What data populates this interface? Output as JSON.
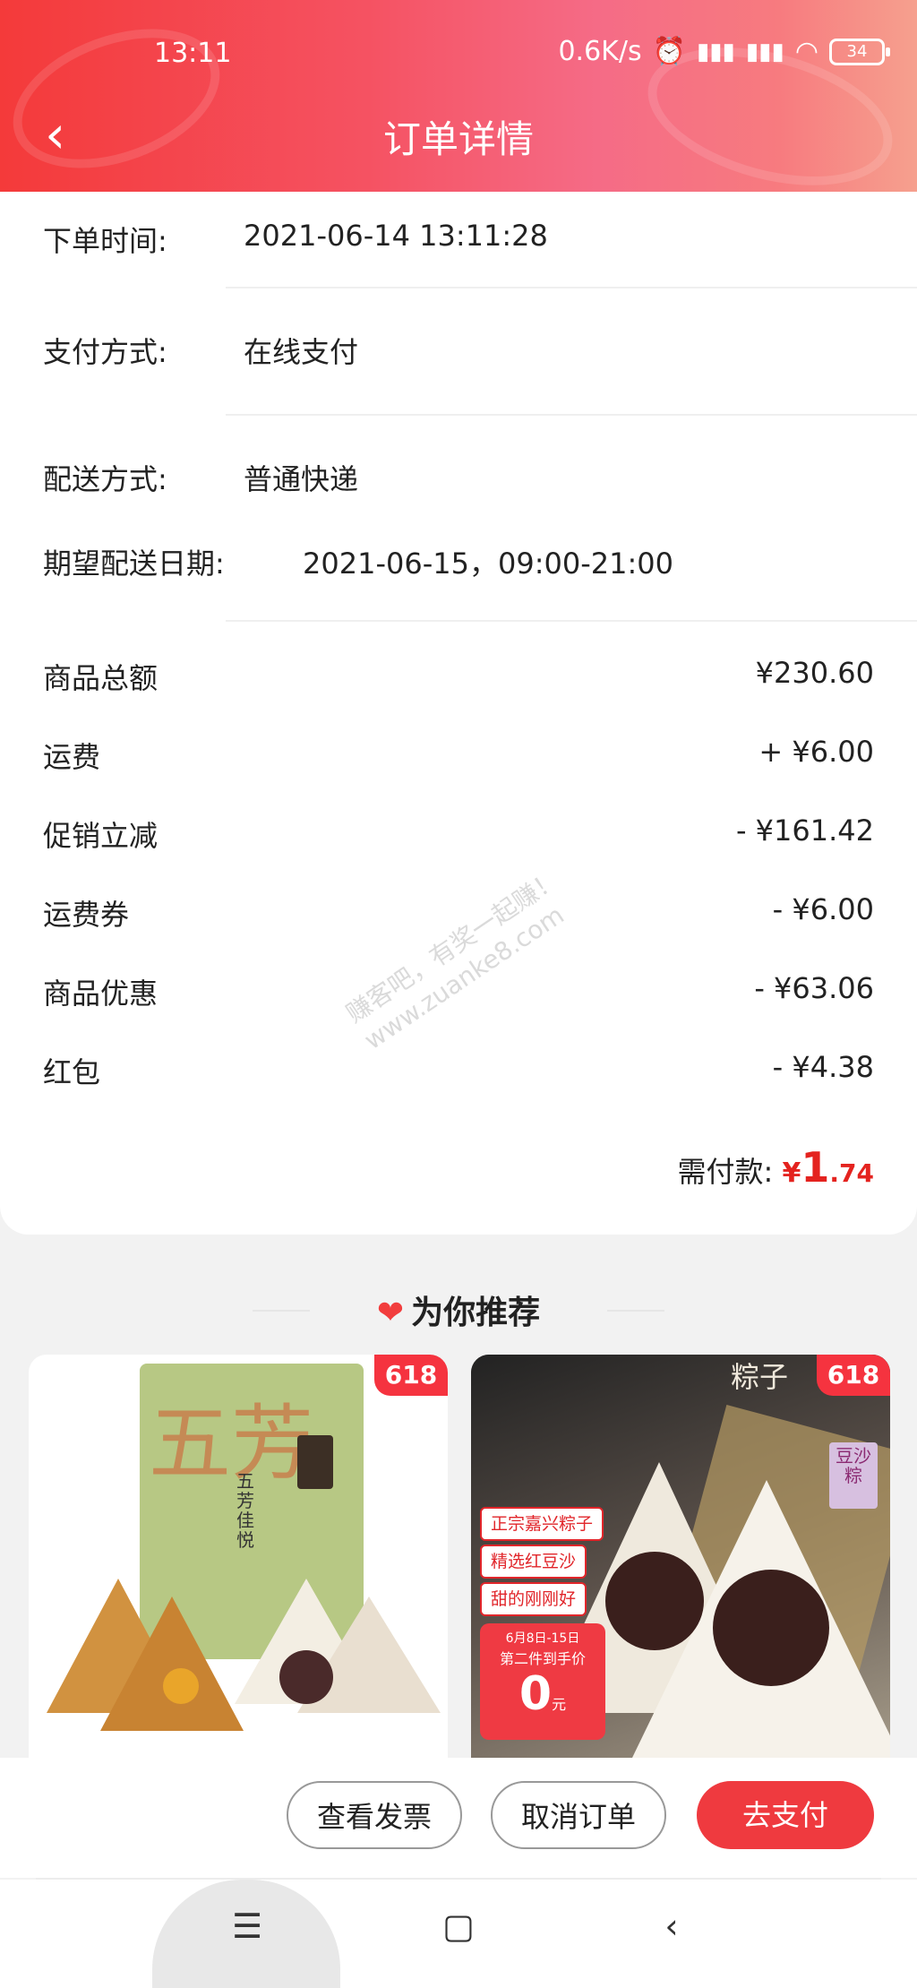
{
  "status_bar": {
    "time": "13:11",
    "speed": "0.6K/s",
    "battery": "34"
  },
  "header": {
    "title": "订单详情"
  },
  "order_info": {
    "order_time_label": "下单时间:",
    "order_time": "2021-06-14 13:11:28",
    "payment_label": "支付方式:",
    "payment": "在线支付",
    "delivery_label": "配送方式:",
    "delivery": "普通快递",
    "expected_label": "期望配送日期:",
    "expected": "2021-06-15，09:00-21:00"
  },
  "fees": [
    {
      "label": "商品总额",
      "value": "¥230.60"
    },
    {
      "label": "运费",
      "value": "+ ¥6.00"
    },
    {
      "label": "促销立减",
      "value": "- ¥161.42"
    },
    {
      "label": "运费券",
      "value": "- ¥6.00"
    },
    {
      "label": "商品优惠",
      "value": "- ¥63.06"
    },
    {
      "label": "红包",
      "value": "- ¥4.38"
    }
  ],
  "payment_due": {
    "label": "需付款:",
    "yen": "¥",
    "integer": "1",
    "decimal": ".74"
  },
  "watermark": {
    "line1": "赚客吧，有奖一起赚！",
    "line2": "www.zuanke8.com"
  },
  "recommend": {
    "title": "为你推荐",
    "products": [
      {
        "tag": "618",
        "brand_big": "五芳",
        "brand_small": "五芳佳悦"
      },
      {
        "tag": "618",
        "top_char": "粽子",
        "side_label": "豆沙粽",
        "badges": [
          "正宗嘉兴粽子",
          "精选红豆沙",
          "甜的刚刚好"
        ],
        "promo_date": "6月8日-15日",
        "promo_text": "第二件到手价",
        "promo_price": "0",
        "promo_unit": "元"
      }
    ]
  },
  "actions": {
    "invoice": "查看发票",
    "cancel": "取消订单",
    "pay": "去支付"
  },
  "colors": {
    "accent": "#ef3a3f",
    "price_red": "#e4231f"
  }
}
